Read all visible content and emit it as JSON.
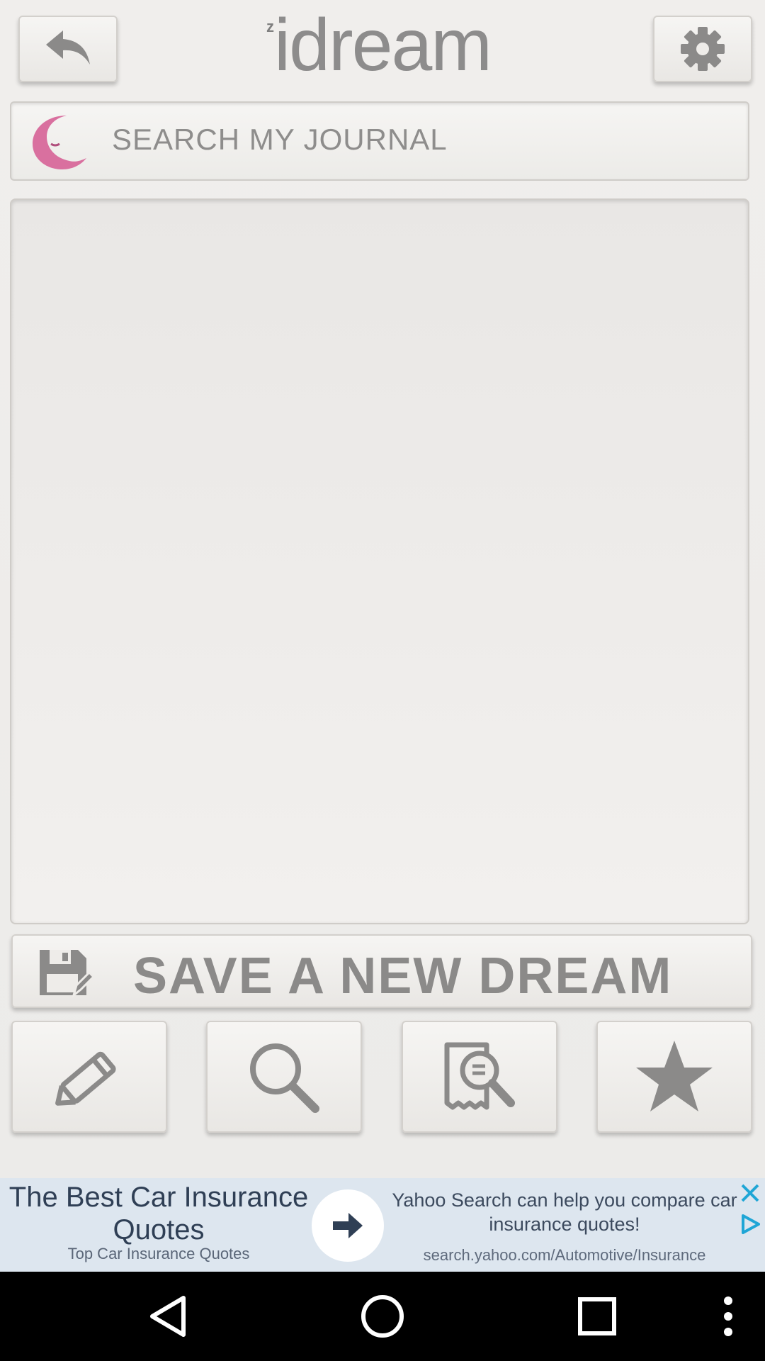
{
  "app": {
    "title": "idream",
    "title_z": "z",
    "search_placeholder": "SEARCH MY JOURNAL",
    "save_label": "SAVE A NEW DREAM",
    "toolbar": [
      "pencil-icon",
      "magnifier-icon",
      "journal-search-icon",
      "star-icon"
    ],
    "colors": {
      "moon": "#d9709f",
      "icon_gray": "#8b8a89",
      "ad_bg": "#dde6ef"
    }
  },
  "ad": {
    "headline": "The Best Car Insurance Quotes",
    "subline": "Top Car Insurance Quotes",
    "body": "Yahoo Search can help you compare car insurance quotes!",
    "url": "search.yahoo.com/Automotive/Insurance"
  }
}
